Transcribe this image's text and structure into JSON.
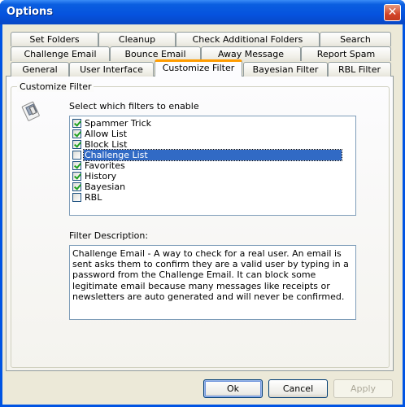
{
  "window": {
    "title": "Options",
    "close_glyph": "✕"
  },
  "tabs": {
    "row1": [
      "Set Folders",
      "Cleanup",
      "Check Additional Folders",
      "Search"
    ],
    "row2": [
      "Challenge Email",
      "Bounce Email",
      "Away Message",
      "Report Spam"
    ],
    "row3": [
      "General",
      "User Interface",
      "Customize Filter",
      "Bayesian Filter",
      "RBL Filter"
    ],
    "active": "Customize Filter"
  },
  "group": {
    "title": "Customize Filter",
    "icon": "filter-icon"
  },
  "filters": {
    "prompt": "Select which filters to enable",
    "items": [
      {
        "label": "Spammer Trick",
        "checked": true
      },
      {
        "label": "Allow List",
        "checked": true
      },
      {
        "label": "Block List",
        "checked": true
      },
      {
        "label": "Challenge List",
        "checked": false,
        "selected": true
      },
      {
        "label": "Favorites",
        "checked": true
      },
      {
        "label": "History",
        "checked": true
      },
      {
        "label": "Bayesian",
        "checked": true
      },
      {
        "label": "RBL",
        "checked": false
      }
    ]
  },
  "description": {
    "label": "Filter Description:",
    "text": "Challenge Email - A way to check for a real user. An email is sent asks them to confirm they are a valid user by typing in a password from the Challenge Email. It can block some legitimate email because many messages like receipts or newsletters are auto generated and will never be confirmed."
  },
  "buttons": {
    "ok": "Ok",
    "cancel": "Cancel",
    "apply": "Apply"
  },
  "colors": {
    "titlebar": "#0553de",
    "selection": "#316ac5",
    "active_tab_accent": "#ff9c00"
  }
}
